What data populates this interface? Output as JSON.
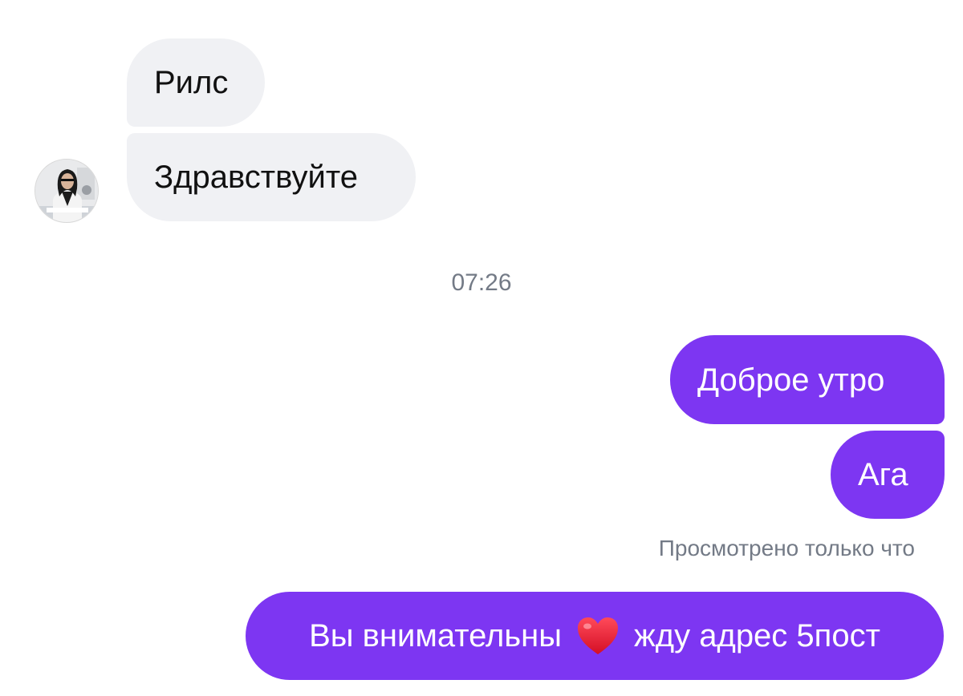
{
  "thread": {
    "incoming": [
      {
        "text": "Рилс"
      },
      {
        "text": "Здравствуйте"
      }
    ],
    "timestamp": "07:26",
    "outgoing": [
      {
        "text": "Доброе утро"
      },
      {
        "text": "Ага"
      }
    ],
    "seen_status": "Просмотрено только что",
    "last_message": {
      "text_before_icon": "Вы внимательны",
      "icon": "red-heart-emoji",
      "text_after_icon": "жду адрес 5пост"
    }
  },
  "colors": {
    "incoming_bubble": "#f0f1f4",
    "outgoing_bubble": "#7d36f2",
    "meta_text": "#737a86"
  }
}
